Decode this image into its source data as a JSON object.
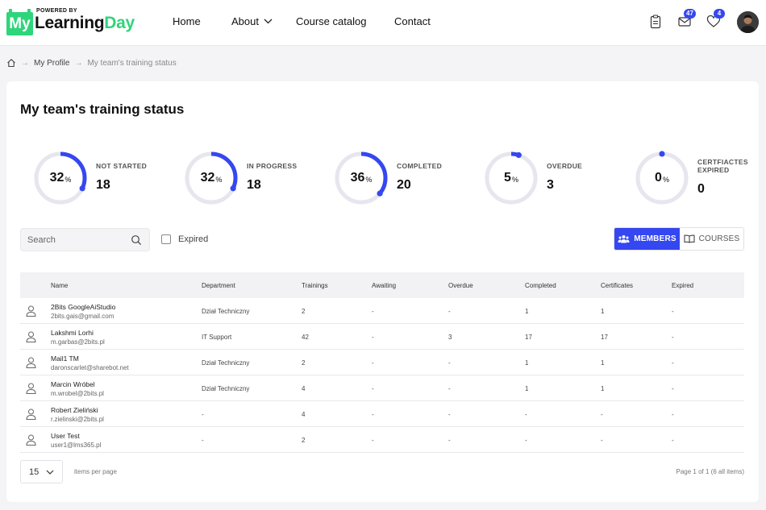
{
  "header": {
    "logo": {
      "powered": "POWERED BY",
      "my": "My",
      "word1": "Learning",
      "word2": "Day"
    },
    "nav": [
      {
        "label": "Home"
      },
      {
        "label": "About"
      },
      {
        "label": "Course catalog"
      },
      {
        "label": "Contact"
      }
    ],
    "icons": {
      "tasks": "clipboard-icon",
      "messages": "mail-icon",
      "wishlist": "heart-icon"
    },
    "messages_badge": "47",
    "wishlist_badge": "4"
  },
  "breadcrumb": {
    "home_icon": "home-icon",
    "items": [
      "My Profile",
      "My team's training status"
    ]
  },
  "page": {
    "title": "My team's training status",
    "accent": "#3547f0",
    "ring_track": "#e6e6ee"
  },
  "stats": [
    {
      "label": "NOT STARTED",
      "percent": 32,
      "percent_text": "32",
      "count": "18"
    },
    {
      "label": "IN PROGRESS",
      "percent": 32,
      "percent_text": "32",
      "count": "18"
    },
    {
      "label": "COMPLETED",
      "percent": 36,
      "percent_text": "36",
      "count": "20"
    },
    {
      "label_lines": [
        "OVERDUE"
      ],
      "label": "OVERDUE",
      "percent": 5,
      "percent_text": "5",
      "count": "3"
    },
    {
      "label_lines": [
        "CERTFIACTES",
        "EXPIRED"
      ],
      "label": "CERTFIACTES EXPIRED",
      "percent": 0,
      "percent_text": "0",
      "count": "0"
    }
  ],
  "percent_sign": "%",
  "filters": {
    "search_placeholder": "Search",
    "expired_label": "Expired",
    "expired_checked": false,
    "view_members": "MEMBERS",
    "view_courses": "COURSES",
    "active_view": "MEMBERS"
  },
  "table": {
    "columns": [
      "Name",
      "Department",
      "Trainings",
      "Awaiting",
      "Overdue",
      "Completed",
      "Certificates",
      "Expired"
    ],
    "rows": [
      {
        "name": "2Bits GoogleAiStudio",
        "email": "2bits.gais@gmail.com",
        "department": "Dział Techniczny",
        "trainings": "2",
        "awaiting": "-",
        "overdue": "-",
        "completed": "1",
        "certificates": "1",
        "expired": "-"
      },
      {
        "name": "Lakshmi Lorhi",
        "email": "m.garbas@2bits.pl",
        "department": "IT Support",
        "trainings": "42",
        "awaiting": "-",
        "overdue": "3",
        "completed": "17",
        "certificates": "17",
        "expired": "-"
      },
      {
        "name": "Mail1 TM",
        "email": "daronscarlet@sharebot.net",
        "department": "Dział Techniczny",
        "trainings": "2",
        "awaiting": "-",
        "overdue": "-",
        "completed": "1",
        "certificates": "1",
        "expired": "-"
      },
      {
        "name": "Marcin Wróbel",
        "email": "m.wrobel@2bits.pl",
        "department": "Dział Techniczny",
        "trainings": "4",
        "awaiting": "-",
        "overdue": "-",
        "completed": "1",
        "certificates": "1",
        "expired": "-"
      },
      {
        "name": "Robert Zieliński",
        "email": "r.zielinski@2bits.pl",
        "department": "-",
        "trainings": "4",
        "awaiting": "-",
        "overdue": "-",
        "completed": "-",
        "certificates": "-",
        "expired": "-"
      },
      {
        "name": "User Test",
        "email": "user1@lms365.pl",
        "department": "-",
        "trainings": "2",
        "awaiting": "-",
        "overdue": "-",
        "completed": "-",
        "certificates": "-",
        "expired": "-"
      }
    ]
  },
  "pagination": {
    "per_page": "15",
    "per_page_label": "items per page",
    "summary": "Page 1 of 1 (6 all items)"
  }
}
